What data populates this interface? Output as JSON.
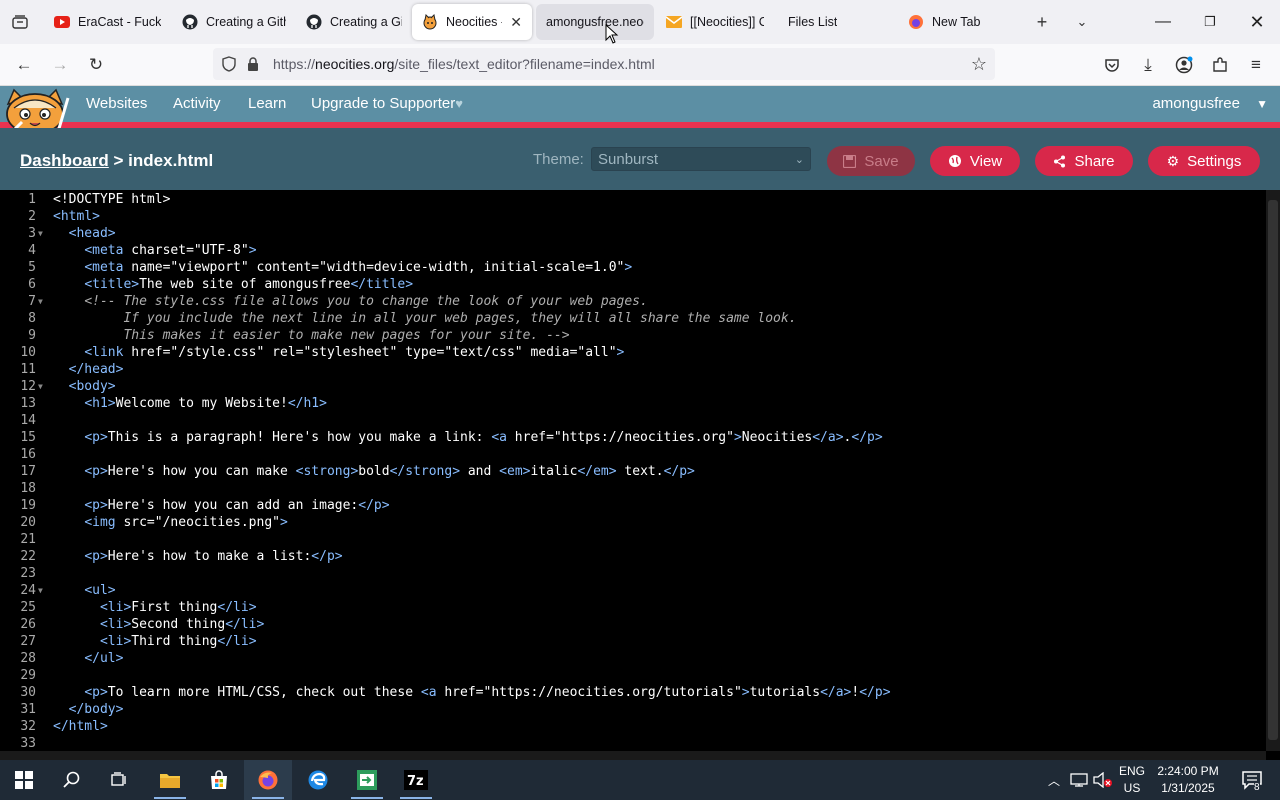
{
  "browser": {
    "tabs": [
      {
        "title": "EraCast - Fuck",
        "icon": "youtube-icon"
      },
      {
        "title": "Creating a Gith",
        "icon": "github-icon"
      },
      {
        "title": "Creating a Gith",
        "icon": "github-icon"
      },
      {
        "title": "Neocities - E",
        "icon": "neocities-icon",
        "active": true
      },
      {
        "title": "amongusfree.neoc",
        "icon": "none"
      },
      {
        "title": "[[Neocities]] Co",
        "icon": "mail-icon"
      },
      {
        "title": "Files List",
        "icon": "none"
      },
      {
        "title": "New Tab",
        "icon": "firefox-icon"
      }
    ],
    "url_prefix": "https://",
    "url_domain": "neocities.org",
    "url_path": "/site_files/text_editor?filename=index.html"
  },
  "site": {
    "nav": [
      "Websites",
      "Activity",
      "Learn",
      "Upgrade to Supporter"
    ],
    "heart": "♥",
    "user": "amongusfree",
    "crumb_dashboard": "Dashboard",
    "crumb_sep": " > ",
    "crumb_file": "index.html",
    "theme_label": "Theme:",
    "theme_value": "Sunburst",
    "buttons": {
      "save": "Save",
      "view": "View",
      "share": "Share",
      "settings": "Settings"
    },
    "colors": {
      "header": "#5c8fa4",
      "accent": "#e93250",
      "crumbbar": "#3a5f6f"
    }
  },
  "editor": {
    "lines": [
      "<!DOCTYPE html>",
      "<html>",
      "  <head>",
      "    <meta charset=\"UTF-8\">",
      "    <meta name=\"viewport\" content=\"width=device-width, initial-scale=1.0\">",
      "    <title>The web site of amongusfree</title>",
      "    <!-- The style.css file allows you to change the look of your web pages.",
      "         If you include the next line in all your web pages, they will all share the same look.",
      "         This makes it easier to make new pages for your site. -->",
      "    <link href=\"/style.css\" rel=\"stylesheet\" type=\"text/css\" media=\"all\">",
      "  </head>",
      "  <body>",
      "    <h1>Welcome to my Website!</h1>",
      "",
      "    <p>This is a paragraph! Here's how you make a link: <a href=\"https://neocities.org\">Neocities</a>.</p>",
      "",
      "    <p>Here's how you can make <strong>bold</strong> and <em>italic</em> text.</p>",
      "",
      "    <p>Here's how you can add an image:</p>",
      "    <img src=\"/neocities.png\">",
      "",
      "    <p>Here's how to make a list:</p>",
      "",
      "    <ul>",
      "      <li>First thing</li>",
      "      <li>Second thing</li>",
      "      <li>Third thing</li>",
      "    </ul>",
      "",
      "    <p>To learn more HTML/CSS, check out these <a href=\"https://neocities.org/tutorials\">tutorials</a>!</p>",
      "  </body>",
      "</html>",
      ""
    ],
    "fold_lines": [
      3,
      7,
      12,
      24
    ]
  },
  "taskbar": {
    "lang_top": "ENG",
    "lang_bottom": "US",
    "time": "2:24:00 PM",
    "date": "1/31/2025",
    "notifications": "8"
  }
}
